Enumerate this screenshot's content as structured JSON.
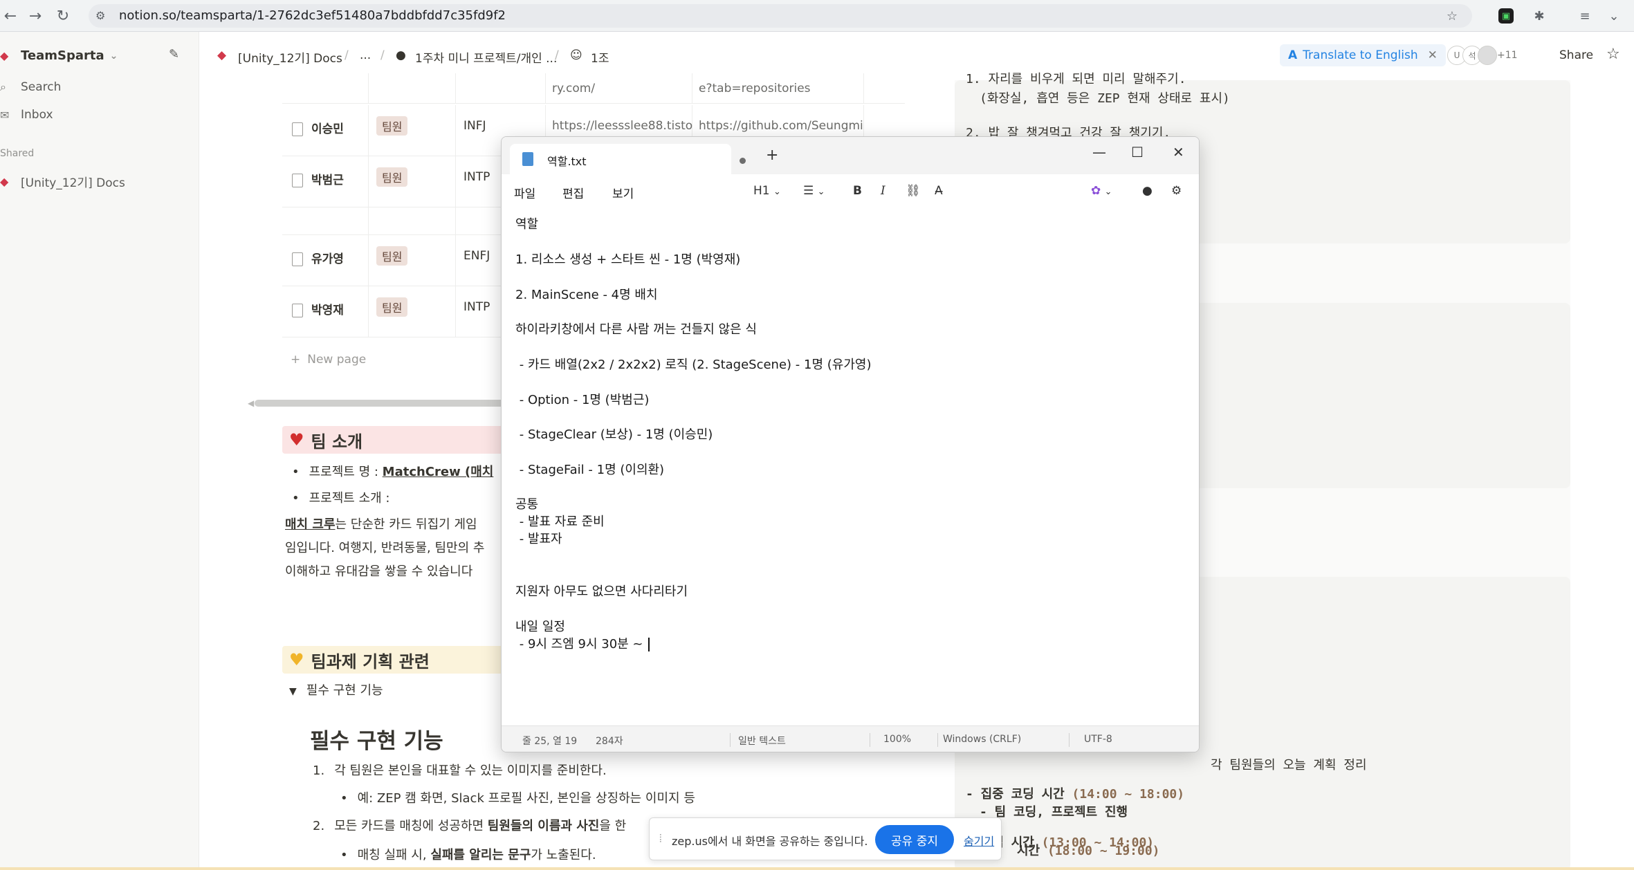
{
  "browser": {
    "url": "notion.so/teamsparta/1-2762dc3ef51480a7bddbfdd7c35fd9f2"
  },
  "sidebar": {
    "workspace": "TeamSparta",
    "search": "Search",
    "inbox": "Inbox",
    "shared_label": "Shared",
    "shared_item": "[Unity_12기] Docs"
  },
  "breadcrumb": {
    "item1": "[Unity_12기] Docs",
    "ellipsis": "...",
    "item2": "1주차 미니 프로젝트/개인 ...",
    "item3": "1조"
  },
  "topbar": {
    "translate": "Translate to English",
    "avatar_u": "U",
    "avatar_k": "석",
    "plus_count": "+11",
    "share": "Share"
  },
  "table": {
    "partial_row": {
      "link1": "ry.com/",
      "link2": "e?tab=repositories"
    },
    "rows": [
      {
        "name": "이승민",
        "role": "팀원",
        "mbti": "INFJ",
        "blog": "https://leessslee88.tisto",
        "github": "https://github.com/Seungmi"
      },
      {
        "name": "박범근",
        "role": "팀원",
        "mbti": "INTP",
        "blog": "",
        "github": ""
      },
      {
        "name": "유가영",
        "role": "팀원",
        "mbti": "ENFJ",
        "blog": "",
        "github": ""
      },
      {
        "name": "박영재",
        "role": "팀원",
        "mbti": "INTP",
        "blog": "",
        "github": ""
      }
    ],
    "new_page": "New page"
  },
  "team_intro": {
    "heading": "팀 소개",
    "bullet1_label": "프로젝트 명 : ",
    "bullet1_value": "MatchCrew (매치",
    "bullet2": "프로젝트 소개 :",
    "para_bold": "매치 크루",
    "para_line1": "는 단순한 카드 뒤집기 게임",
    "para_line2": "임입니다. 여행지, 반려동물, 팀만의 추",
    "para_line3": "이해하고 유대감을 쌓을 수 있습니다"
  },
  "planning": {
    "heading": "팀과제 기획 관련",
    "toggle": "필수 구현 기능",
    "h2": "필수 구현 기능",
    "item1": "각 팀원은 본인을 대표할 수 있는 이미지를 준비한다.",
    "item1_sub": "예: ZEP 캠 화면, Slack 프로필 사진, 본인을 상징하는 이미지 등",
    "item2_a": "모든 카드를 매칭에 성공하면 ",
    "item2_b": "팀원들의 이름과 사진",
    "item2_c": "을 한",
    "item2_sub_a": "매칭 실패 시, ",
    "item2_sub_b": "실패를 알리는 문구",
    "item2_sub_c": "가 노출된다."
  },
  "right_panel": {
    "line1": "1. 자리를 비우게 되면 미리 말해주기.",
    "line1_sub": "(화장실, 흡연 등은 ZEP 현재 상태로 표시)",
    "line2": "2. 밥 잘 챙겨먹고 건강 잘 챙기기.",
    "plan_tail": "각 팀원들의 오늘 계획 정리",
    "lunch": "- 점심 시간 ",
    "lunch_time": "(13:00 ~ 14:00)",
    "focus": "- 집중 코딩 시간 ",
    "focus_time": "(14:00 ~ 18:00)",
    "focus_sub": "- 팀 코딩, 프로젝트 진행",
    "dinner": "시간 ",
    "dinner_time": "(18:00 ~ 19:00)"
  },
  "notepad": {
    "tab_title": "역할.txt",
    "new_tab": "+",
    "menu": {
      "file": "파일",
      "edit": "편집",
      "view": "보기"
    },
    "toolbar": {
      "heading": "H1"
    },
    "lines": [
      "역할",
      "1. 리소스 생성 + 스타트 씬 - 1명 (박영재)",
      "2. MainScene - 4명 배치",
      "하이라키창에서 다른 사람 꺼는 건들지 않은 식",
      " - 카드 배열(2x2 / 2x2x2) 로직 (2. StageScene) - 1명 (유가영)",
      " - Option - 1명 (박범근)",
      " - StageClear (보상) - 1명 (이승민)",
      " - StageFail - 1명 (이의환)",
      "공통",
      " - 발표 자료 준비",
      " - 발표자",
      "지원자 아무도 없으면 사다리타기",
      "내일 일정",
      " - 9시 즈엠 9시 30분 ~ "
    ],
    "status": {
      "position": "줄 25, 열 19",
      "chars": "284자",
      "mode": "일반 텍스트",
      "zoom": "100%",
      "eol": "Windows (CRLF)",
      "encoding": "UTF-8"
    }
  },
  "sharebar": {
    "message": "zep.us에서 내 화면을 공유하는 중입니다.",
    "stop": "공유 중지",
    "hide": "숨기기"
  },
  "colors": {
    "accent": "#2383e2",
    "tag_bg": "#eee0da",
    "callout_red": "#fbe4e4",
    "callout_yellow": "#fbf3db",
    "share_stop": "#1a73e8"
  }
}
